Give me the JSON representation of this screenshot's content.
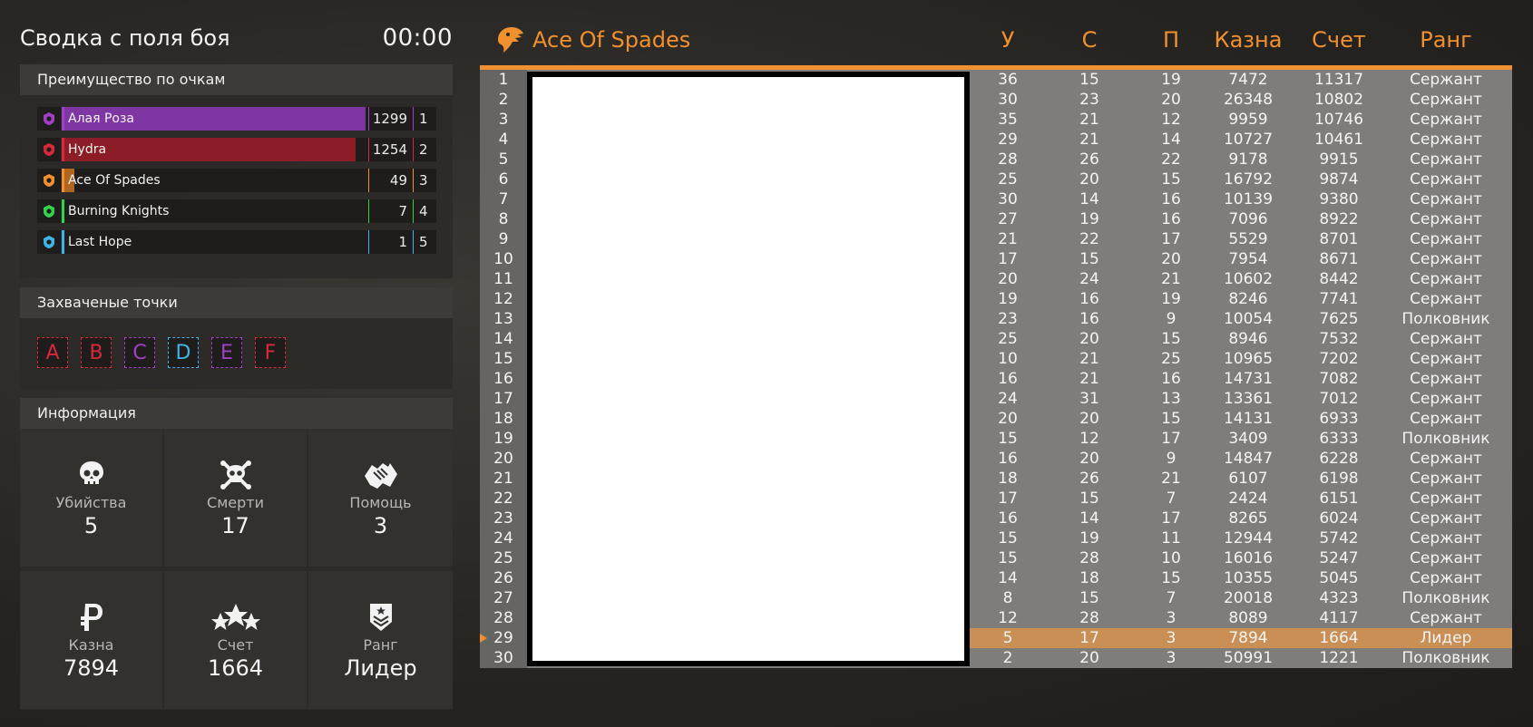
{
  "left": {
    "title": "Сводка с поля боя",
    "timer": "00:00",
    "score_panel": {
      "title": "Преимущество по очкам",
      "teams": [
        {
          "name": "Алая Роза",
          "score": "1299",
          "place": "1",
          "fill": 0.99,
          "color": "#a33fc4",
          "bar_color": "#7e36a3",
          "icon": "rose-icon"
        },
        {
          "name": "Hydra",
          "score": "1254",
          "place": "2",
          "fill": 0.96,
          "color": "#d8283a",
          "bar_color": "#8c1d26",
          "icon": "hydra-icon"
        },
        {
          "name": "Ace Of Spades",
          "score": "49",
          "place": "3",
          "fill": 0.04,
          "color": "#f0902e",
          "bar_color": "#b1661f",
          "icon": "eagle-icon"
        },
        {
          "name": "Burning Knights",
          "score": "7",
          "place": "4",
          "fill": 0.0,
          "color": "#34d24a",
          "bar_color": "#34d24a",
          "icon": "knight-icon"
        },
        {
          "name": "Last Hope",
          "score": "1",
          "place": "5",
          "fill": 0.0,
          "color": "#3fb4e6",
          "bar_color": "#3fb4e6",
          "icon": "hope-icon"
        }
      ]
    },
    "points_panel": {
      "title": "Захваченые точки",
      "points": [
        {
          "letter": "A",
          "color": "#d8283a"
        },
        {
          "letter": "B",
          "color": "#d8283a"
        },
        {
          "letter": "C",
          "color": "#a33fc4"
        },
        {
          "letter": "D",
          "color": "#3fb4e6"
        },
        {
          "letter": "E",
          "color": "#a33fc4"
        },
        {
          "letter": "F",
          "color": "#d8283a"
        }
      ]
    },
    "info_panel": {
      "title": "Информация",
      "cells": [
        {
          "label": "Убийства",
          "value": "5",
          "icon": "skull-icon"
        },
        {
          "label": "Смерти",
          "value": "17",
          "icon": "skull-crossbones-icon"
        },
        {
          "label": "Помощь",
          "value": "3",
          "icon": "handshake-icon"
        },
        {
          "label": "Казна",
          "value": "7894",
          "icon": "ruble-icon"
        },
        {
          "label": "Счет",
          "value": "1664",
          "icon": "stars-icon"
        },
        {
          "label": "Ранг",
          "value": "Лидер",
          "icon": "rank-badge-icon"
        }
      ]
    }
  },
  "table": {
    "team": "Ace Of Spades",
    "columns": [
      "У",
      "С",
      "П",
      "Казна",
      "Счет",
      "Ранг"
    ],
    "accent": "#f0902e",
    "current_player_index": 28,
    "rows": [
      [
        "1",
        "36",
        "15",
        "19",
        "7472",
        "11317",
        "Сержант"
      ],
      [
        "2",
        "30",
        "23",
        "20",
        "26348",
        "10802",
        "Сержант"
      ],
      [
        "3",
        "35",
        "21",
        "12",
        "9959",
        "10746",
        "Сержант"
      ],
      [
        "4",
        "29",
        "21",
        "14",
        "10727",
        "10461",
        "Сержант"
      ],
      [
        "5",
        "28",
        "26",
        "22",
        "9178",
        "9915",
        "Сержант"
      ],
      [
        "6",
        "25",
        "20",
        "15",
        "16792",
        "9874",
        "Сержант"
      ],
      [
        "7",
        "30",
        "14",
        "16",
        "10139",
        "9380",
        "Сержант"
      ],
      [
        "8",
        "27",
        "19",
        "16",
        "7096",
        "8922",
        "Сержант"
      ],
      [
        "9",
        "21",
        "22",
        "17",
        "5529",
        "8701",
        "Сержант"
      ],
      [
        "10",
        "17",
        "15",
        "20",
        "7954",
        "8671",
        "Сержант"
      ],
      [
        "11",
        "20",
        "24",
        "21",
        "10602",
        "8442",
        "Сержант"
      ],
      [
        "12",
        "19",
        "16",
        "19",
        "8246",
        "7741",
        "Сержант"
      ],
      [
        "13",
        "23",
        "16",
        "9",
        "10054",
        "7625",
        "Полковник"
      ],
      [
        "14",
        "25",
        "20",
        "15",
        "8946",
        "7532",
        "Сержант"
      ],
      [
        "15",
        "10",
        "21",
        "25",
        "10965",
        "7202",
        "Сержант"
      ],
      [
        "16",
        "16",
        "21",
        "16",
        "14731",
        "7082",
        "Сержант"
      ],
      [
        "17",
        "24",
        "31",
        "13",
        "13361",
        "7012",
        "Сержант"
      ],
      [
        "18",
        "20",
        "20",
        "15",
        "14131",
        "6933",
        "Сержант"
      ],
      [
        "19",
        "15",
        "12",
        "17",
        "3409",
        "6333",
        "Полковник"
      ],
      [
        "20",
        "16",
        "20",
        "9",
        "14847",
        "6228",
        "Сержант"
      ],
      [
        "21",
        "18",
        "26",
        "21",
        "6107",
        "6198",
        "Сержант"
      ],
      [
        "22",
        "17",
        "15",
        "7",
        "2424",
        "6151",
        "Сержант"
      ],
      [
        "23",
        "16",
        "14",
        "17",
        "8265",
        "6024",
        "Сержант"
      ],
      [
        "24",
        "15",
        "19",
        "11",
        "12944",
        "5742",
        "Сержант"
      ],
      [
        "25",
        "15",
        "28",
        "10",
        "16016",
        "5247",
        "Сержант"
      ],
      [
        "26",
        "14",
        "18",
        "15",
        "10355",
        "5045",
        "Сержант"
      ],
      [
        "27",
        "8",
        "15",
        "7",
        "20018",
        "4323",
        "Полковник"
      ],
      [
        "28",
        "12",
        "28",
        "3",
        "8089",
        "4117",
        "Сержант"
      ],
      [
        "29",
        "5",
        "17",
        "3",
        "7894",
        "1664",
        "Лидер"
      ],
      [
        "30",
        "2",
        "20",
        "3",
        "50991",
        "1221",
        "Полковник"
      ]
    ]
  }
}
